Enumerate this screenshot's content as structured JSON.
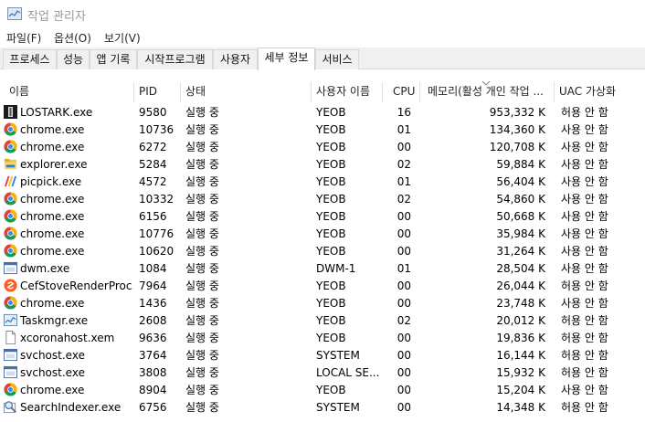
{
  "window": {
    "title": "작업 관리자"
  },
  "menu": [
    "파일(F)",
    "옵션(O)",
    "보기(V)"
  ],
  "tabs": [
    {
      "label": "프로세스",
      "active": false
    },
    {
      "label": "성능",
      "active": false
    },
    {
      "label": "앱 기록",
      "active": false
    },
    {
      "label": "시작프로그램",
      "active": false
    },
    {
      "label": "사용자",
      "active": false
    },
    {
      "label": "세부 정보",
      "active": true
    },
    {
      "label": "서비스",
      "active": false
    }
  ],
  "columns": {
    "name": "이름",
    "pid": "PID",
    "status": "상태",
    "user": "사용자 이름",
    "cpu": "CPU",
    "memory": "메모리(활성 개인 작업 ...",
    "uac": "UAC 가상화"
  },
  "rows": [
    {
      "name": "LOSTARK.exe",
      "icon": "lostark-icon",
      "pid": "9580",
      "status": "실행 중",
      "user": "YEOB",
      "cpu": "16",
      "mem": "953,332 K",
      "uac": "허용 안 함"
    },
    {
      "name": "chrome.exe",
      "icon": "chrome-icon",
      "pid": "10736",
      "status": "실행 중",
      "user": "YEOB",
      "cpu": "01",
      "mem": "134,360 K",
      "uac": "사용 안 함"
    },
    {
      "name": "chrome.exe",
      "icon": "chrome-icon",
      "pid": "6272",
      "status": "실행 중",
      "user": "YEOB",
      "cpu": "00",
      "mem": "120,708 K",
      "uac": "사용 안 함"
    },
    {
      "name": "explorer.exe",
      "icon": "folder-icon",
      "pid": "5284",
      "status": "실행 중",
      "user": "YEOB",
      "cpu": "02",
      "mem": "59,884 K",
      "uac": "사용 안 함"
    },
    {
      "name": "picpick.exe",
      "icon": "picpick-icon",
      "pid": "4572",
      "status": "실행 중",
      "user": "YEOB",
      "cpu": "01",
      "mem": "56,404 K",
      "uac": "사용 안 함"
    },
    {
      "name": "chrome.exe",
      "icon": "chrome-icon",
      "pid": "10332",
      "status": "실행 중",
      "user": "YEOB",
      "cpu": "02",
      "mem": "54,860 K",
      "uac": "사용 안 함"
    },
    {
      "name": "chrome.exe",
      "icon": "chrome-icon",
      "pid": "6156",
      "status": "실행 중",
      "user": "YEOB",
      "cpu": "00",
      "mem": "50,668 K",
      "uac": "사용 안 함"
    },
    {
      "name": "chrome.exe",
      "icon": "chrome-icon",
      "pid": "10776",
      "status": "실행 중",
      "user": "YEOB",
      "cpu": "00",
      "mem": "35,984 K",
      "uac": "사용 안 함"
    },
    {
      "name": "chrome.exe",
      "icon": "chrome-icon",
      "pid": "10620",
      "status": "실행 중",
      "user": "YEOB",
      "cpu": "00",
      "mem": "31,264 K",
      "uac": "사용 안 함"
    },
    {
      "name": "dwm.exe",
      "icon": "window-icon",
      "pid": "1084",
      "status": "실행 중",
      "user": "DWM-1",
      "cpu": "01",
      "mem": "28,504 K",
      "uac": "사용 안 함"
    },
    {
      "name": "CefStoveRenderProc...",
      "icon": "stove-icon",
      "pid": "7964",
      "status": "실행 중",
      "user": "YEOB",
      "cpu": "00",
      "mem": "26,044 K",
      "uac": "허용 안 함"
    },
    {
      "name": "chrome.exe",
      "icon": "chrome-icon",
      "pid": "1436",
      "status": "실행 중",
      "user": "YEOB",
      "cpu": "00",
      "mem": "23,748 K",
      "uac": "사용 안 함"
    },
    {
      "name": "Taskmgr.exe",
      "icon": "taskmgr-icon",
      "pid": "2608",
      "status": "실행 중",
      "user": "YEOB",
      "cpu": "02",
      "mem": "20,012 K",
      "uac": "허용 안 함"
    },
    {
      "name": "xcoronahost.xem",
      "icon": "file-icon",
      "pid": "9636",
      "status": "실행 중",
      "user": "YEOB",
      "cpu": "00",
      "mem": "19,836 K",
      "uac": "허용 안 함"
    },
    {
      "name": "svchost.exe",
      "icon": "window-icon",
      "pid": "3764",
      "status": "실행 중",
      "user": "SYSTEM",
      "cpu": "00",
      "mem": "16,144 K",
      "uac": "허용 안 함"
    },
    {
      "name": "svchost.exe",
      "icon": "window-icon",
      "pid": "3808",
      "status": "실행 중",
      "user": "LOCAL SE...",
      "cpu": "00",
      "mem": "15,932 K",
      "uac": "허용 안 함"
    },
    {
      "name": "chrome.exe",
      "icon": "chrome-icon",
      "pid": "8904",
      "status": "실행 중",
      "user": "YEOB",
      "cpu": "00",
      "mem": "15,204 K",
      "uac": "사용 안 함"
    },
    {
      "name": "SearchIndexer.exe",
      "icon": "search-indexer-icon",
      "pid": "6756",
      "status": "실행 중",
      "user": "SYSTEM",
      "cpu": "00",
      "mem": "14,348 K",
      "uac": "허용 안 함"
    }
  ]
}
